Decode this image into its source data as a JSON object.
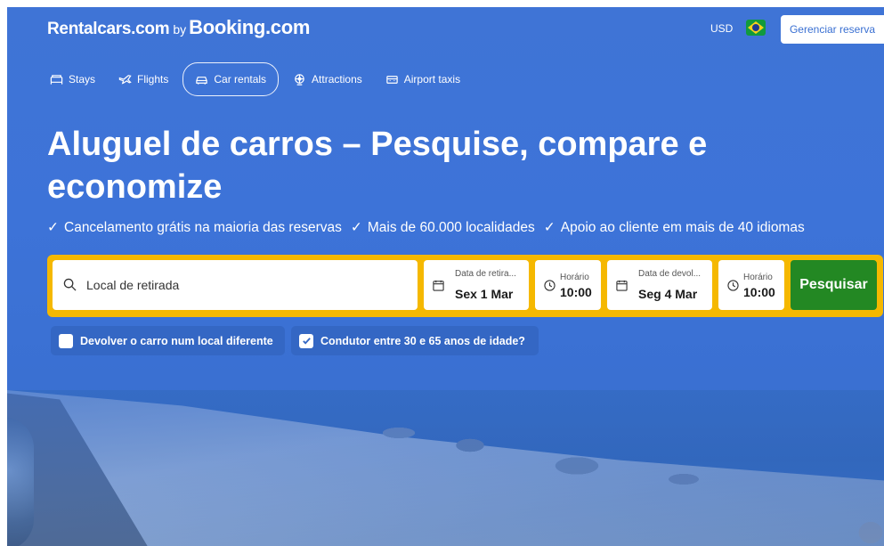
{
  "header": {
    "logo_rentalcars": "Rentalcars.com",
    "logo_by": "by",
    "logo_booking": "Booking.com",
    "currency": "USD",
    "manage_booking": "Gerenciar reserva"
  },
  "nav": {
    "items": [
      {
        "label": "Stays",
        "icon": "bed-icon"
      },
      {
        "label": "Flights",
        "icon": "plane-icon"
      },
      {
        "label": "Car rentals",
        "icon": "car-icon",
        "active": true
      },
      {
        "label": "Attractions",
        "icon": "attractions-icon"
      },
      {
        "label": "Airport taxis",
        "icon": "taxi-icon"
      }
    ]
  },
  "hero": {
    "title": "Aluguel de carros – Pesquise, compare e economize",
    "benefits": [
      "Cancelamento grátis na maioria das reservas",
      "Mais de 60.000 localidades",
      "Apoio ao cliente em mais de 40 idiomas"
    ],
    "check_mark": "✓"
  },
  "search": {
    "location_placeholder": "Local de retirada",
    "pickup_date_label": "Data de retira...",
    "pickup_date_value": "Sex 1 Mar",
    "pickup_time_label": "Horário",
    "pickup_time_value": "10:00",
    "return_date_label": "Data de devol...",
    "return_date_value": "Seg 4 Mar",
    "return_time_label": "Horário",
    "return_time_value": "10:00",
    "submit_label": "Pesquisar"
  },
  "options": {
    "different_return_label": "Devolver o carro num local diferente",
    "different_return_checked": false,
    "driver_age_label": "Condutor entre 30 e 65 anos de idade?",
    "driver_age_checked": true
  },
  "colors": {
    "brand_blue": "#3a70d2",
    "search_border": "#f5b800",
    "search_button": "#238823"
  }
}
